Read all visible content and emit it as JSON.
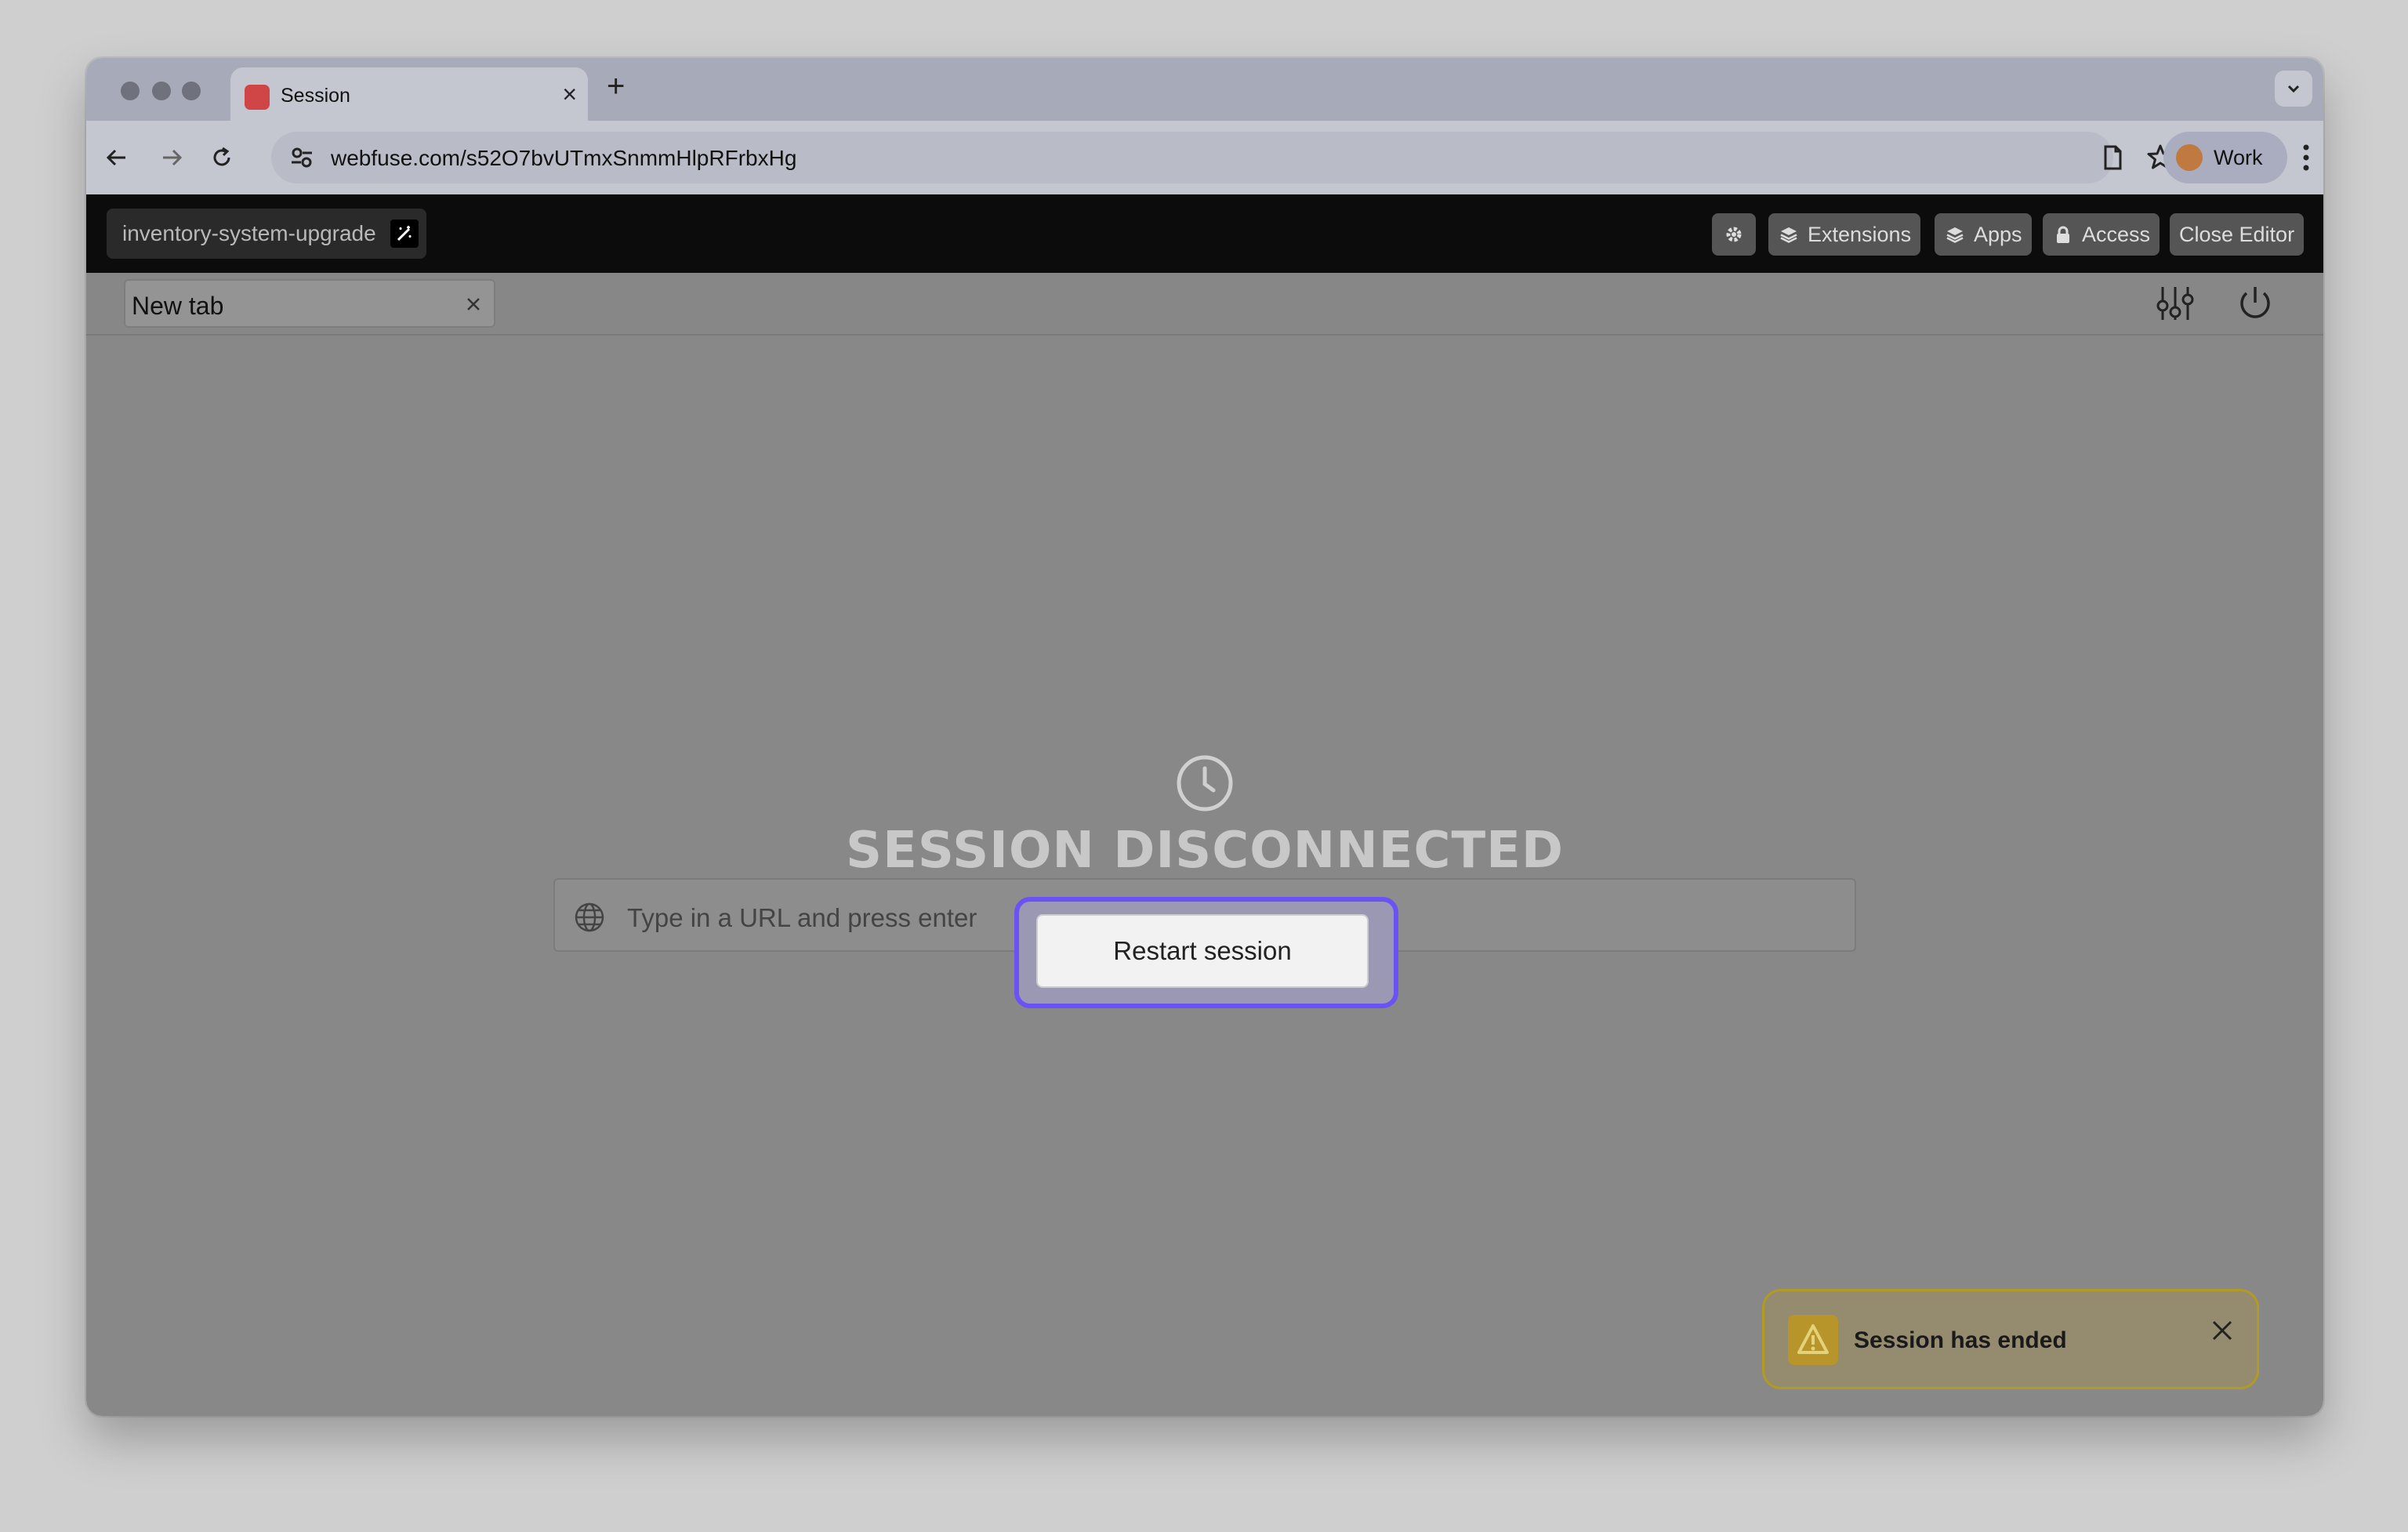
{
  "browser": {
    "tab_title": "Session",
    "tab_close": "×",
    "new_tab": "+",
    "url": "webfuse.com/s52O7bvUTmxSnmmHlpRFrbxHg",
    "profile": "Work"
  },
  "appbar": {
    "project_name": "inventory-system-upgrade",
    "buttons": {
      "extensions": "Extensions",
      "apps": "Apps",
      "access": "Access",
      "close_editor": "Close Editor"
    }
  },
  "session": {
    "tab_label": "New tab",
    "url_placeholder": "Type in a URL and press enter",
    "headline": "SESSION DISCONNECTED",
    "restart_label": "Restart session"
  },
  "toast": {
    "message": "Session has ended"
  },
  "icons": {
    "tab_favicon": "webfuse-favicon",
    "back": "arrow-left-icon",
    "forward": "arrow-right-icon",
    "reload": "reload-icon",
    "site_settings": "tune-icon",
    "page": "document-icon",
    "bookmark": "star-icon",
    "menu": "kebab-icon",
    "settings": "gear-icon",
    "extensions": "layers-icon",
    "apps": "layers-icon",
    "access": "lock-icon",
    "session_settings": "sliders-icon",
    "power": "power-icon",
    "globe": "globe-icon",
    "clock": "clock-icon",
    "warning": "warning-icon",
    "close": "close-icon"
  },
  "colors": {
    "focus_ring": "#6a52f5",
    "toast_border": "#b29a25",
    "appbar_bg": "#0c0c0c"
  }
}
